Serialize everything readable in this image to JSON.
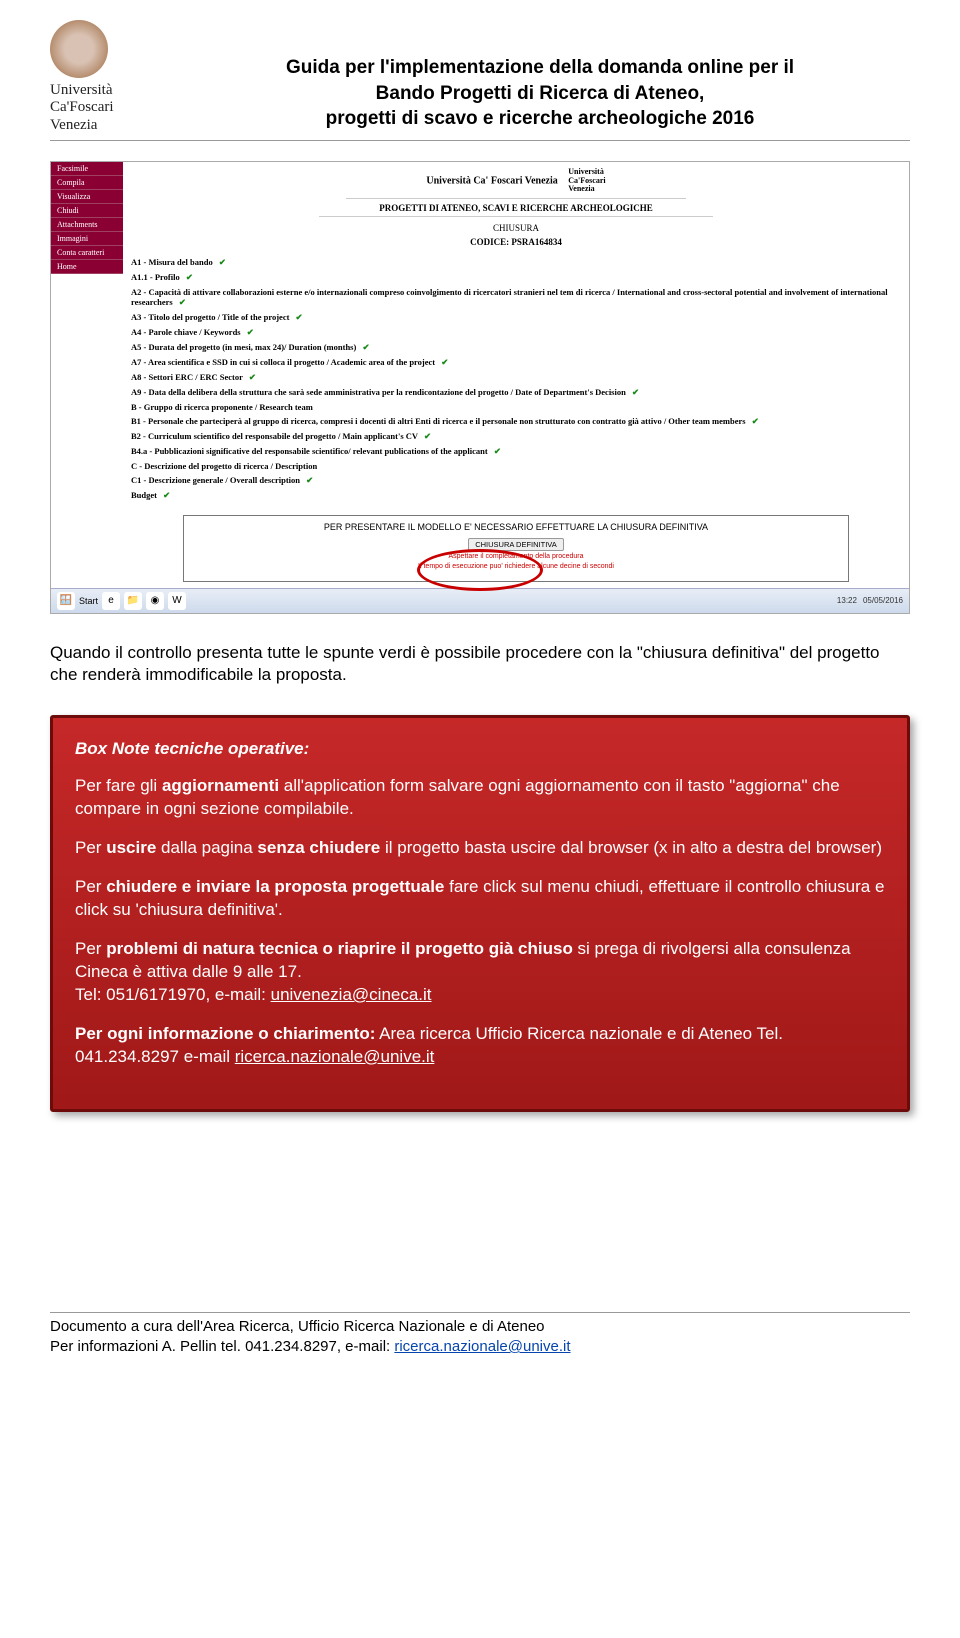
{
  "header": {
    "logo": {
      "line1": "Università",
      "line2": "Ca'Foscari",
      "line3": "Venezia"
    },
    "title_line1": "Guida per l'implementazione della domanda online per il",
    "title_line2": "Bando Progetti di Ricerca di Ateneo,",
    "title_line3": "progetti di scavo e ricerche archeologiche 2016"
  },
  "screenshot": {
    "sidebar": [
      "Facsimile",
      "Compila",
      "Visualizza",
      "Chiudi",
      "Attachments",
      "Immagini",
      "Conta caratteri",
      "Home"
    ],
    "uni": "Università Ca' Foscari Venezia",
    "small_logo_l1": "Università",
    "small_logo_l2": "Ca'Foscari",
    "small_logo_l3": "Venezia",
    "sub": "PROGETTI DI ATENEO, SCAVI E RICERCHE ARCHEOLOGICHE",
    "chiusura": "CHIUSURA",
    "codice": "CODICE: PSRA164834",
    "items": [
      "A1 - Misura del bando",
      "A1.1 - Profilo",
      "A2 - Capacità di attivare collaborazioni esterne e/o internazionali compreso coinvolgimento di ricercatori stranieri nel tem di ricerca / International and cross-sectoral potential and involvement of international researchers",
      "A3 - Titolo del progetto / Title of the project",
      "A4 - Parole chiave / Keywords",
      "A5 - Durata del progetto (in mesi, max 24)/ Duration (months)",
      "A7 - Area scientifica e SSD in cui si colloca il progetto / Academic area of the project",
      "A8 - Settori ERC / ERC Sector",
      "A9 - Data della delibera della struttura che sarà sede amministrativa per la rendicontazione del progetto / Date of Department's Decision",
      "B - Gruppo di ricerca proponente / Research team",
      "B1 - Personale che parteciperà al gruppo di ricerca, compresi i docenti di altri Enti di ricerca e il personale non strutturato con contratto già attivo / Other team members",
      "B2 - Curriculum scientifico del responsabile del progetto / Main applicant's CV",
      "B4.a - Pubblicazioni significative del responsabile scientifico/ relevant publications of the applicant",
      "C - Descrizione del progetto di ricerca / Description",
      "C1 - Descrizione generale / Overall description",
      "Budget"
    ],
    "nocheck": [
      9,
      13
    ],
    "notice_line": "PER PRESENTARE IL MODELLO E' NECESSARIO EFFETTUARE LA CHIUSURA DEFINITIVA",
    "button_label": "CHIUSURA DEFINITIVA",
    "tiny1": "Aspettare il completamento della procedura",
    "tiny2": "Il tempo di esecuzione puo' richiedere alcune decine di secondi",
    "taskbar": {
      "start": "Start",
      "time": "13:22",
      "date": "05/05/2016"
    }
  },
  "body_para": "Quando il controllo presenta tutte le spunte verdi è possibile procedere con la \"chiusura definitiva\" del progetto che renderà immodificabile la proposta.",
  "note": {
    "title": "Box Note tecniche operative:",
    "p1a": "Per fare gli ",
    "p1b": "aggiornamenti",
    "p1c": " all'application form salvare ogni aggiornamento con il tasto \"aggiorna\" che compare in ogni sezione compilabile.",
    "p2a": "Per ",
    "p2b": "uscire",
    "p2c": " dalla pagina ",
    "p2d": "senza chiudere",
    "p2e": " il progetto basta uscire dal browser (x in alto a destra del browser)",
    "p3a": "Per ",
    "p3b": "chiudere e inviare la proposta progettuale",
    "p3c": " fare click sul menu chiudi, effettuare il controllo chiusura e click su 'chiusura definitiva'.",
    "p4a": "Per ",
    "p4b": "problemi di natura tecnica o riaprire il progetto già chiuso",
    "p4c": " si prega di rivolgersi alla consulenza Cineca è attiva dalle 9 alle 17.",
    "p4d": "Tel: 051/6171970, e-mail: ",
    "p4e": "univenezia@cineca.it",
    "p5a": "Per ogni informazione o chiarimento:",
    "p5b": " Area ricerca Ufficio Ricerca nazionale e di Ateneo Tel. 041.234.8297 e-mail  ",
    "p5c": "ricerca.nazionale@unive.it"
  },
  "footer": {
    "line1": "Documento a cura dell'Area Ricerca, Ufficio Ricerca Nazionale e  di Ateneo",
    "line2a": "Per informazioni A. Pellin tel. 041.234.8297, e-mail: ",
    "line2b": "ricerca.nazionale@unive.it"
  }
}
